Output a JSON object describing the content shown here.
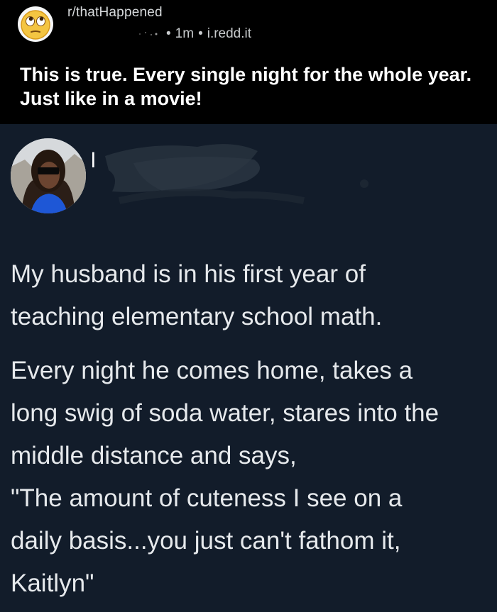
{
  "post": {
    "subreddit": "r/thatHappened",
    "age": "1m",
    "domain": "i.redd.it",
    "title": "This is true. Every single night for the whole year. Just like in a movie!",
    "subreddit_icon": "face-with-rolling-eyes-icon"
  },
  "tweet": {
    "author_initial": "l",
    "lines": [
      "My husband is in his first year of",
      "teaching elementary school math.",
      "Every night he comes home, takes a",
      "long swig of soda water, stares into the",
      "middle distance and says,",
      "\"The amount of cuteness I see on a",
      "daily basis...you just can't fathom it,",
      "Kaitlyn\""
    ]
  },
  "colors": {
    "header_background": "#000000",
    "tweet_background": "#121c2a",
    "text_primary": "#ffffff",
    "text_secondary": "#d7dadc",
    "tweet_text": "#e6e9ec",
    "emoji_yellow": "#f4c542"
  }
}
